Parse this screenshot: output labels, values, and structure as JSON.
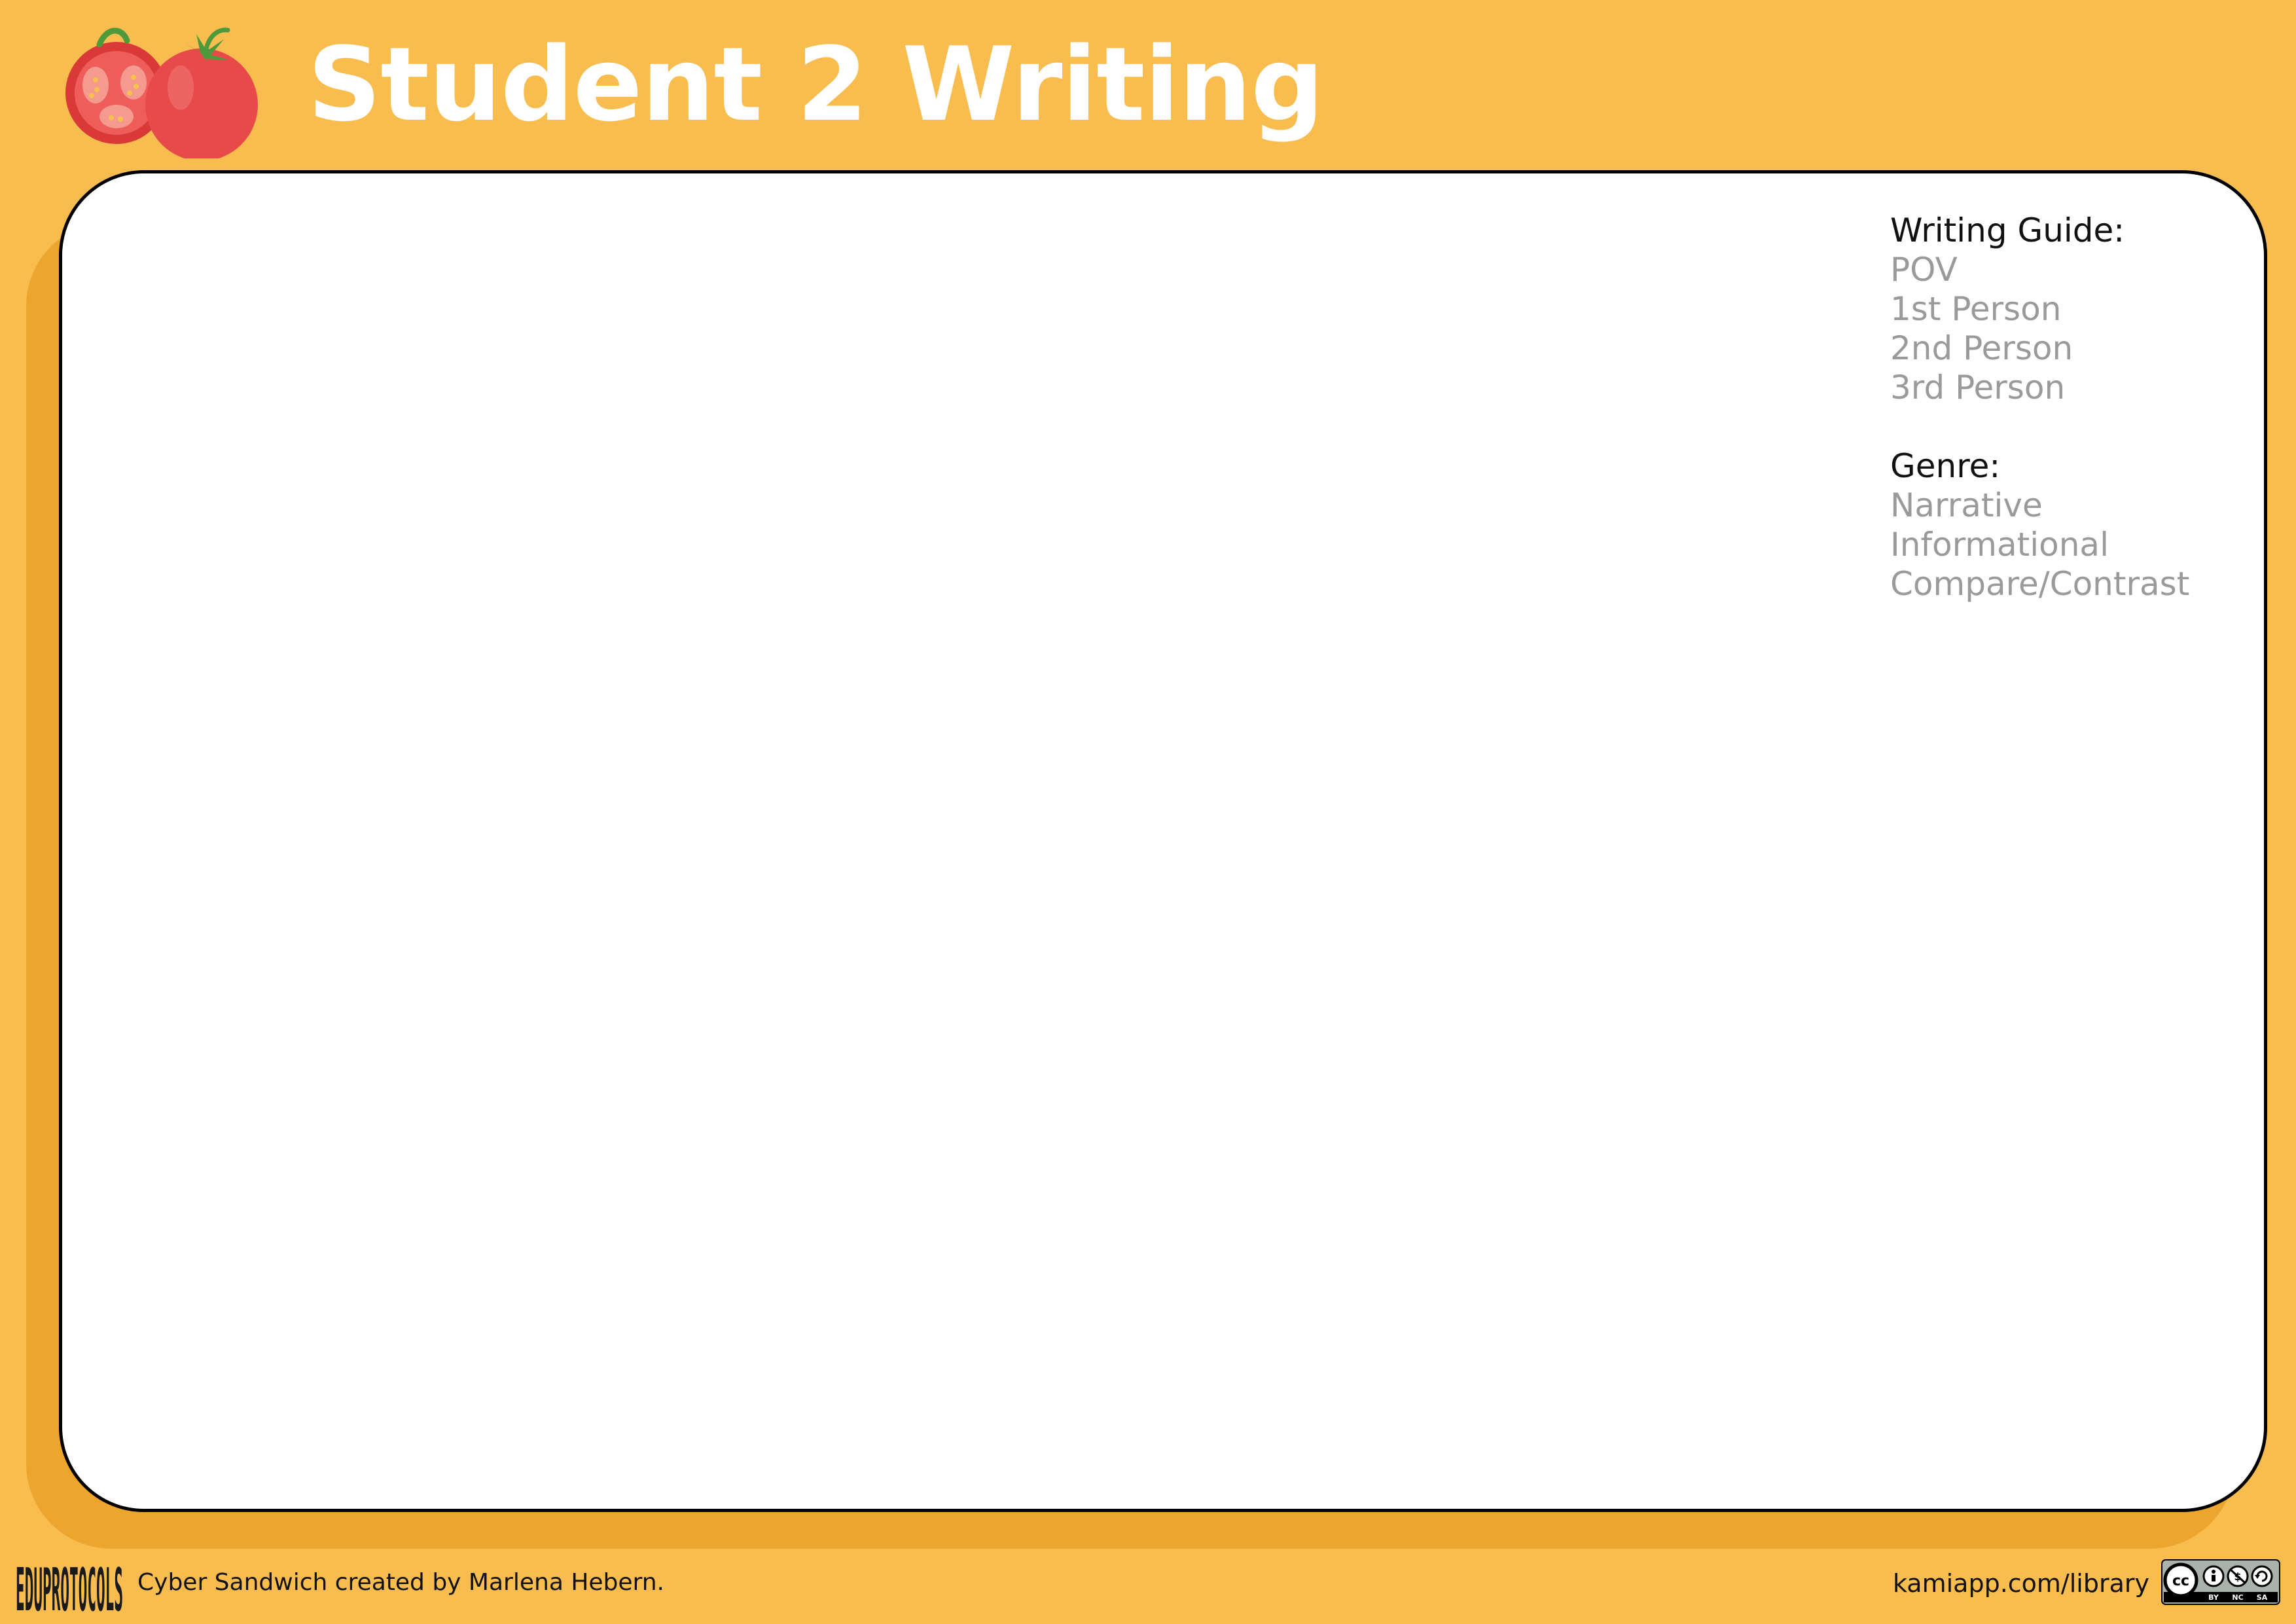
{
  "header": {
    "title": "Student 2 Writing",
    "icon": "tomato-icon"
  },
  "card": {
    "writing_guide": {
      "heading": "Writing Guide:",
      "items": [
        "POV",
        "1st Person",
        "2nd Person",
        "3rd Person"
      ]
    },
    "genre": {
      "heading": "Genre:",
      "items": [
        "Narrative",
        "Informational",
        "Compare/Contrast"
      ]
    }
  },
  "footer": {
    "logo_text": "EDUPROTOCOLS",
    "credit": "Cyber Sandwich created by Marlena Hebern.",
    "url": "kamiapp.com/library",
    "license": {
      "cc": "cc",
      "by": "BY",
      "nc": "NC",
      "sa": "SA"
    }
  },
  "colors": {
    "background": "#F9BC4E",
    "card_shadow": "#ECA62E",
    "card": "#FFFFFF",
    "tomato": "#E84A4A",
    "muted_text": "#9A9A9A"
  }
}
